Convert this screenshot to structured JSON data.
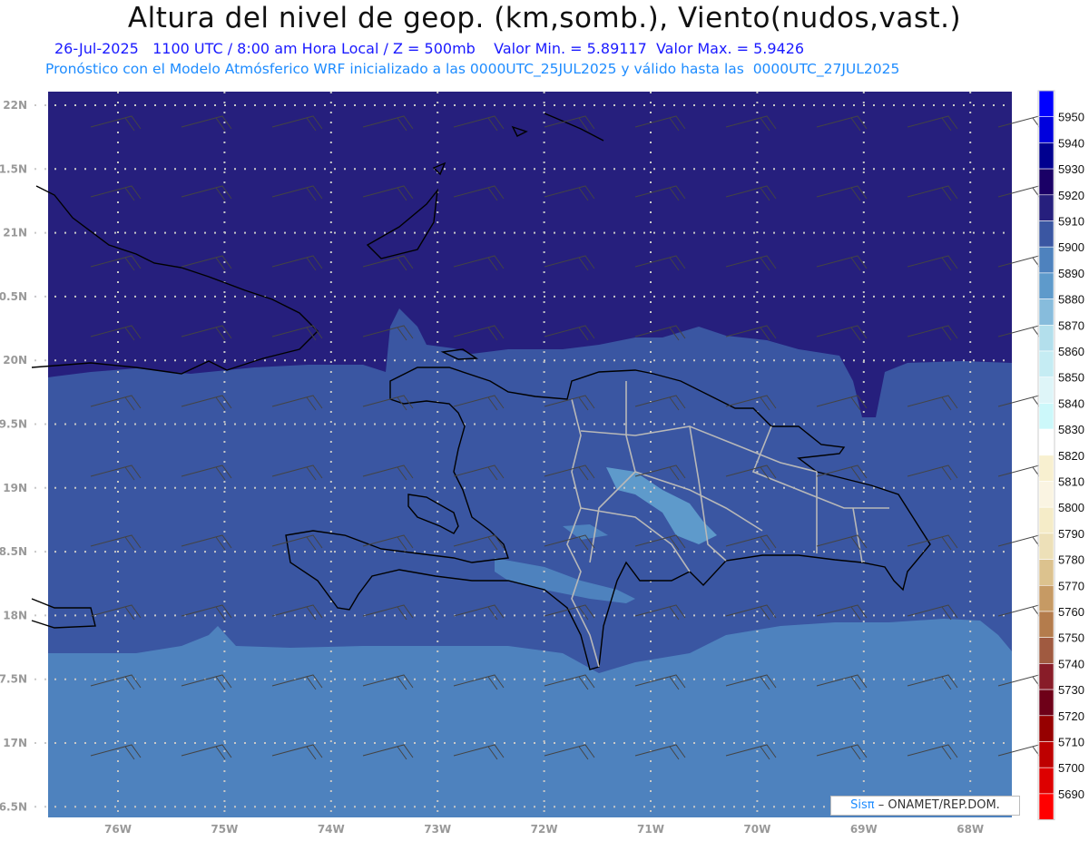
{
  "header": {
    "title": "Altura del nivel de geop. (km,somb.), Viento(nudos,vast.)",
    "line2_date": "26-Jul-2025",
    "line2_time": "1100 UTC / 8:00 am Hora Local / Z = 500mb",
    "line2_min": "Valor Min. = 5.89117",
    "line2_max": "Valor Max. = 5.9426",
    "line3": "Pronóstico con el Modelo Atmósferico WRF inicializado a las 0000UTC_25JUL2025 y válido hasta las  0000UTC_27JUL2025"
  },
  "axes": {
    "lon_labels": [
      "76W",
      "75W",
      "74W",
      "73W",
      "72W",
      "71W",
      "70W",
      "69W",
      "68W"
    ],
    "lat_labels": [
      "22N",
      "1.5N",
      "21N",
      "0.5N",
      "20N",
      "9.5N",
      "19N",
      "8.5N",
      "18N",
      "7.5N",
      "17N",
      "6.5N"
    ]
  },
  "colorbar": {
    "labels": [
      "5950",
      "5940",
      "5930",
      "5920",
      "5910",
      "5900",
      "5890",
      "5880",
      "5870",
      "5860",
      "5850",
      "5840",
      "5830",
      "5820",
      "5810",
      "5800",
      "5790",
      "5780",
      "5770",
      "5760",
      "5750",
      "5740",
      "5730",
      "5720",
      "5710",
      "5700",
      "5690"
    ],
    "colors": [
      "#0000ff",
      "#0000dd",
      "#00008f",
      "#1a0066",
      "#261f7d",
      "#3a56a2",
      "#4e82be",
      "#5e9acb",
      "#87bcdc",
      "#b3dfec",
      "#c5ecf3",
      "#def5f8",
      "#ccf8fa",
      "#ffffff",
      "#f8f0d0",
      "#faf4e2",
      "#f5ecc8",
      "#ede0b8",
      "#dcc28e",
      "#c69a64",
      "#b47c4c",
      "#a05a40",
      "#881c28",
      "#6e0018",
      "#960000",
      "#be0000",
      "#dd0000",
      "#ff0000"
    ]
  },
  "credit": {
    "brand": "Sisπ",
    "text": "– ONAMET/REP.DOM."
  }
}
